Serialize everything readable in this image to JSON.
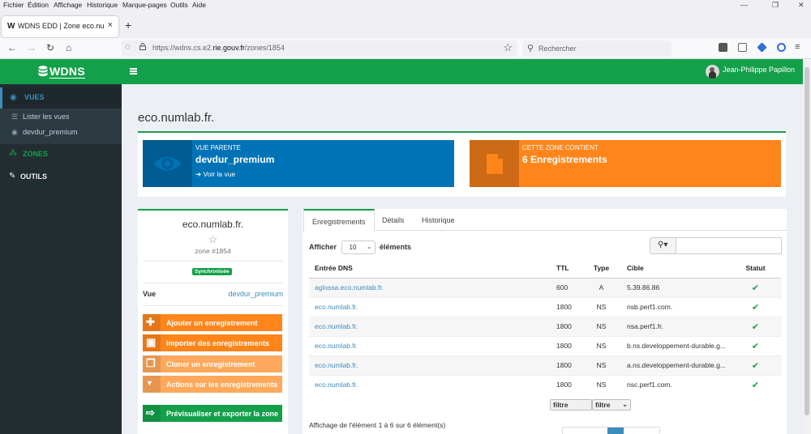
{
  "browser": {
    "menu": [
      "Fichier",
      "Édition",
      "Affichage",
      "Historique",
      "Marque-pages",
      "Outils",
      "Aide"
    ],
    "tab_title": "WDNS EDD | Zone eco.numlab.fr.",
    "tab_favicon": "W",
    "url_prefix": "https://wdns.cs.e2.",
    "url_domain": "rie.gouv.fr",
    "url_path": "/zones/1854",
    "search_placeholder": "Rechercher"
  },
  "app": {
    "logo_text": "WDNS",
    "user_name": "Jean-Philippe Papillon",
    "brand_color": "#14a04a"
  },
  "sidebar": {
    "vues_label": "VUES",
    "sub_items": [
      {
        "label": "Lister les vues",
        "icon": "list-icon"
      },
      {
        "label": "devdur_premium",
        "icon": "eye-icon"
      }
    ],
    "zones_label": "ZONES",
    "outils_label": "OUTILS"
  },
  "page": {
    "title": "eco.numlab.fr.",
    "parent_box": {
      "small": "VUE PARENTE",
      "big": "devdur_premium",
      "link": "Voir la vue"
    },
    "content_box": {
      "small": "CETTE ZONE CONTIENT",
      "big": "6 Enregistrements"
    }
  },
  "zone_card": {
    "name": "eco.numlab.fr.",
    "zone_id": "zone #1854",
    "status": "Synchronisée",
    "vue_key": "Vue",
    "vue_value": "devdur_premium",
    "actions": [
      "Ajouter un enregistrement",
      "Importer des enregistrements",
      "Cloner un enregistrement",
      "Actions sur les enregistrements",
      "Prévisualiser et exporter la zone"
    ]
  },
  "records": {
    "tabs": [
      "Enregistrements",
      "Détails",
      "Historique"
    ],
    "show_label": "Afficher",
    "show_value": "10",
    "show_suffix": "éléments",
    "columns": [
      "Entrée DNS",
      "TTL",
      "Type",
      "Cible",
      "Statut"
    ],
    "rows": [
      {
        "entry": "aglossa.eco.numlab.fr.",
        "ttl": "600",
        "type": "A",
        "target": "5.39.86.86"
      },
      {
        "entry": "eco.numlab.fr.",
        "ttl": "1800",
        "type": "NS",
        "target": "nsb.perf1.com."
      },
      {
        "entry": "eco.numlab.fr.",
        "ttl": "1800",
        "type": "NS",
        "target": "nsa.perf1.fr."
      },
      {
        "entry": "eco.numlab.fr.",
        "ttl": "1800",
        "type": "NS",
        "target": "b.ns.developpement-durable.g..."
      },
      {
        "entry": "eco.numlab.fr.",
        "ttl": "1800",
        "type": "NS",
        "target": "a.ns.developpement-durable.g..."
      },
      {
        "entry": "eco.numlab.fr.",
        "ttl": "1800",
        "type": "NS",
        "target": "nsc.perf1.com."
      }
    ],
    "filter_left": "filtre",
    "filter_right": "filtre",
    "footer": "Affichage de l'élément 1 à 6 sur 6 élément(s)"
  }
}
